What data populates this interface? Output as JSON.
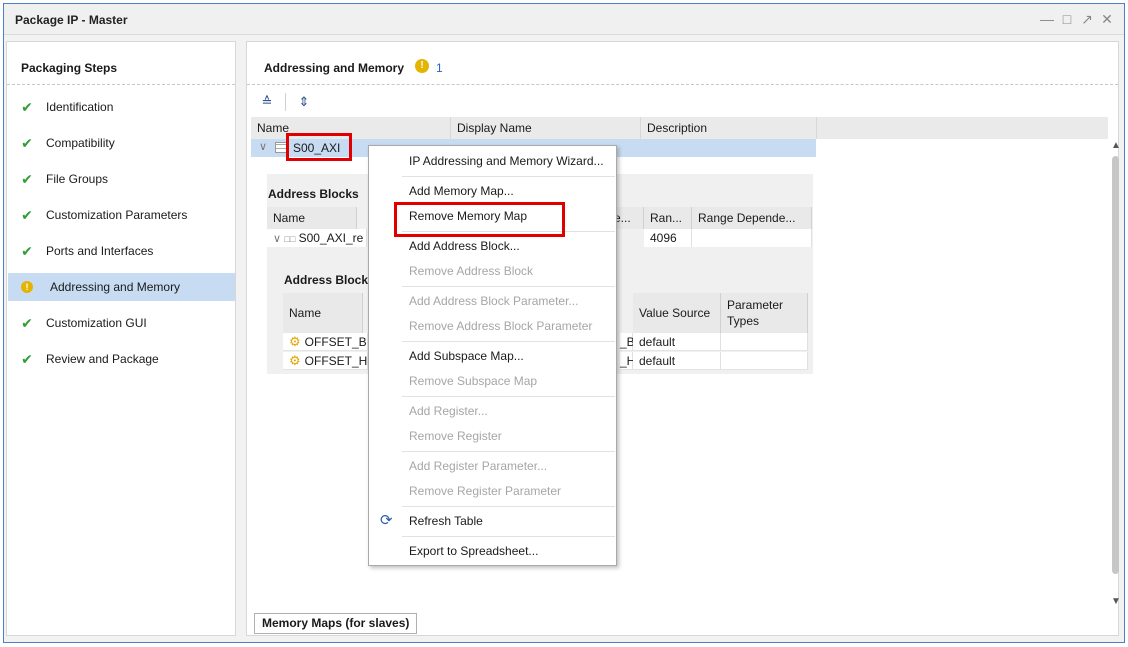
{
  "window": {
    "title": "Package IP - Master",
    "controls": [
      "minimize-icon",
      "maximize-icon",
      "restore-icon",
      "close-icon"
    ]
  },
  "steps": {
    "header": "Packaging Steps",
    "items": [
      {
        "label": "Identification",
        "status": "complete"
      },
      {
        "label": "Compatibility",
        "status": "complete"
      },
      {
        "label": "File Groups",
        "status": "complete"
      },
      {
        "label": "Customization Parameters",
        "status": "complete"
      },
      {
        "label": "Ports and Interfaces",
        "status": "complete"
      },
      {
        "label": "Addressing and Memory",
        "status": "warning",
        "selected": true
      },
      {
        "label": "Customization GUI",
        "status": "complete"
      },
      {
        "label": "Review and Package",
        "status": "complete"
      }
    ]
  },
  "main": {
    "title": "Addressing and Memory",
    "warning_count": "1",
    "toolbar": [
      "collapse-all-icon",
      "expand-all-icon"
    ],
    "columns": [
      "Name",
      "Display Name",
      "Description"
    ],
    "memory_map_row": {
      "name": "S00_AXI"
    },
    "address_blocks": {
      "title": "Address Blocks",
      "col_name": "Name",
      "col_range_truncated": "Ran...",
      "col_range_dep": "Range Depende...",
      "col_trunc": "e...",
      "row_name": "S00_AXI_re",
      "row_range": "4096"
    },
    "address_block_params": {
      "title": "Address Block",
      "col_name": "Name",
      "col_value_source": "Value Source",
      "col_param_types": "Parameter Types",
      "rows": [
        {
          "name": "OFFSET_B",
          "trunc": "_B",
          "value_source": "default"
        },
        {
          "name": "OFFSET_H",
          "trunc": "_H",
          "value_source": "default"
        }
      ]
    },
    "bottom_tab": "Memory Maps (for slaves)"
  },
  "context_menu": {
    "items": [
      {
        "label": "IP Addressing and Memory Wizard...",
        "enabled": true
      },
      {
        "label": "Add Memory Map...",
        "enabled": true
      },
      {
        "label": "Remove Memory Map",
        "enabled": true,
        "highlighted": true
      },
      {
        "label": "Add Address Block...",
        "enabled": true
      },
      {
        "label": "Remove Address Block",
        "enabled": false
      },
      {
        "label": "Add Address Block Parameter...",
        "enabled": false
      },
      {
        "label": "Remove Address Block Parameter",
        "enabled": false
      },
      {
        "label": "Add Subspace Map...",
        "enabled": true
      },
      {
        "label": "Remove Subspace Map",
        "enabled": false
      },
      {
        "label": "Add Register...",
        "enabled": false
      },
      {
        "label": "Remove Register",
        "enabled": false
      },
      {
        "label": "Add Register Parameter...",
        "enabled": false
      },
      {
        "label": "Remove Register Parameter",
        "enabled": false
      },
      {
        "label": "Refresh Table",
        "enabled": true,
        "icon": "refresh-icon"
      },
      {
        "label": "Export to Spreadsheet...",
        "enabled": true
      }
    ]
  },
  "colors": {
    "accent": "#c7dcf2",
    "highlight_box": "#e00000",
    "warning": "#e4b400",
    "check": "#2e9e36"
  }
}
